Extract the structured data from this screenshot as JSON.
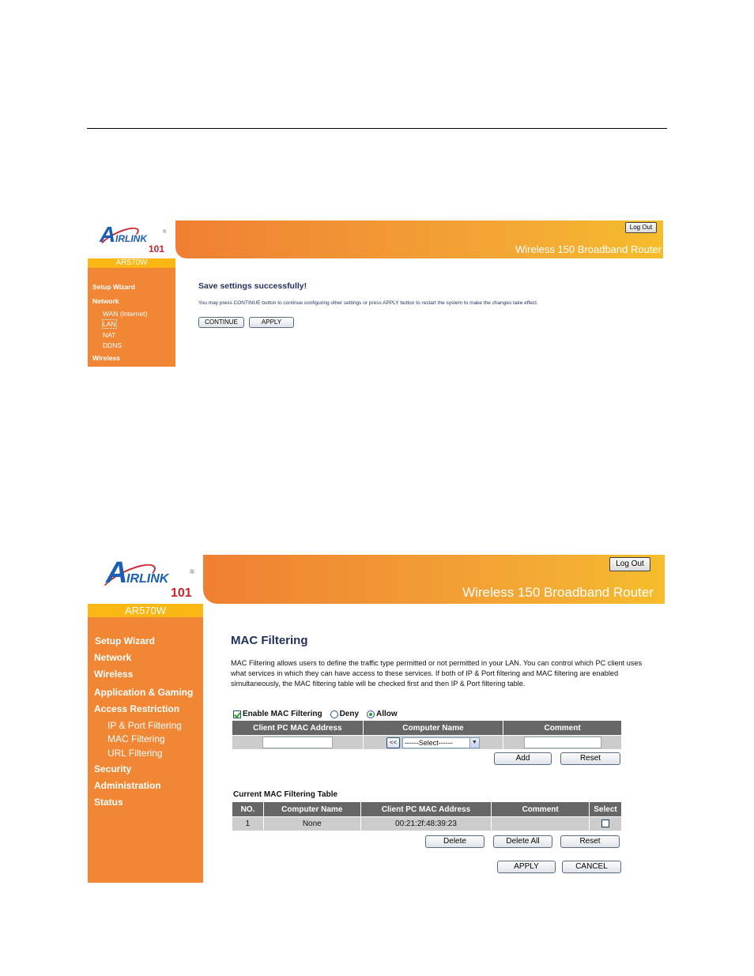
{
  "shared": {
    "brand_logo": "AirLink 101",
    "logo_letter": "A",
    "logo_text": "IRLINK",
    "logo_number": "101",
    "logo_reg": "®",
    "model": "AR570W",
    "banner_title": "Wireless 150 Broadband Router",
    "logout_label": "Log Out"
  },
  "colors": {
    "sidebar": "#f18634",
    "model_bar": "#fbb714",
    "table_header": "#666666",
    "table_cell": "#cccccc",
    "title_text": "#1f2f5c"
  },
  "screen1": {
    "sidebar": {
      "items": [
        {
          "label": "Setup Wizard",
          "type": "section"
        },
        {
          "label": "Network",
          "type": "section"
        },
        {
          "label": "WAN (Internet)",
          "type": "sub"
        },
        {
          "label": "LAN",
          "type": "sub",
          "active": true
        },
        {
          "label": "NAT",
          "type": "sub"
        },
        {
          "label": "DDNS",
          "type": "sub"
        },
        {
          "label": "Wireless",
          "type": "section"
        }
      ]
    },
    "main": {
      "title": "Save settings successfully!",
      "message": "You may press CONTINUE button to continue configuring other settings or press APPLY button to restart the system to make the changes take effect.",
      "buttons": {
        "continue": "CONTINUE",
        "apply": "APPLY"
      }
    }
  },
  "screen2": {
    "sidebar": {
      "items": [
        {
          "label": "Setup Wizard",
          "type": "section"
        },
        {
          "label": "Network",
          "type": "section"
        },
        {
          "label": "Wireless",
          "type": "section"
        },
        {
          "label": "Application & Gaming",
          "type": "section"
        },
        {
          "label": "Access Restriction",
          "type": "section"
        },
        {
          "label": "IP & Port Filtering",
          "type": "sub"
        },
        {
          "label": "MAC Filtering",
          "type": "sub"
        },
        {
          "label": "URL Filtering",
          "type": "sub"
        },
        {
          "label": "Security",
          "type": "section"
        },
        {
          "label": "Administration",
          "type": "section"
        },
        {
          "label": "Status",
          "type": "section"
        }
      ]
    },
    "main": {
      "title": "MAC Filtering",
      "description": "MAC Filtering allows users to define the traffic type permitted or not permitted in your LAN. You can control which PC client uses what services in which they can have access to these services. If both of IP & Port filtering and MAC filtering are enabled simultaneously, the MAC filtering table will be checked first and then IP & Port filtering table.",
      "enable_label": "Enable MAC Filtering",
      "enable_checked": true,
      "deny_label": "Deny",
      "allow_label": "Allow",
      "mode_selected": "Allow",
      "entry_table": {
        "headers": [
          "Client PC MAC Address",
          "Computer Name",
          "Comment"
        ],
        "mac_value": "",
        "copy_button": "<<",
        "computer_select": "------Select------",
        "comment_value": ""
      },
      "add_label": "Add",
      "reset_label": "Reset",
      "current_table": {
        "caption": "Current MAC Filtering Table",
        "headers": [
          "NO.",
          "Computer Name",
          "Client PC MAC Address",
          "Comment",
          "Select"
        ],
        "rows": [
          {
            "no": "1",
            "computer_name": "None",
            "mac": "00:21:2f:48:39:23",
            "comment": "",
            "selected": false
          }
        ]
      },
      "delete_label": "Delete",
      "delete_all_label": "Delete All",
      "table_reset_label": "Reset",
      "apply_label": "APPLY",
      "cancel_label": "CANCEL"
    }
  }
}
